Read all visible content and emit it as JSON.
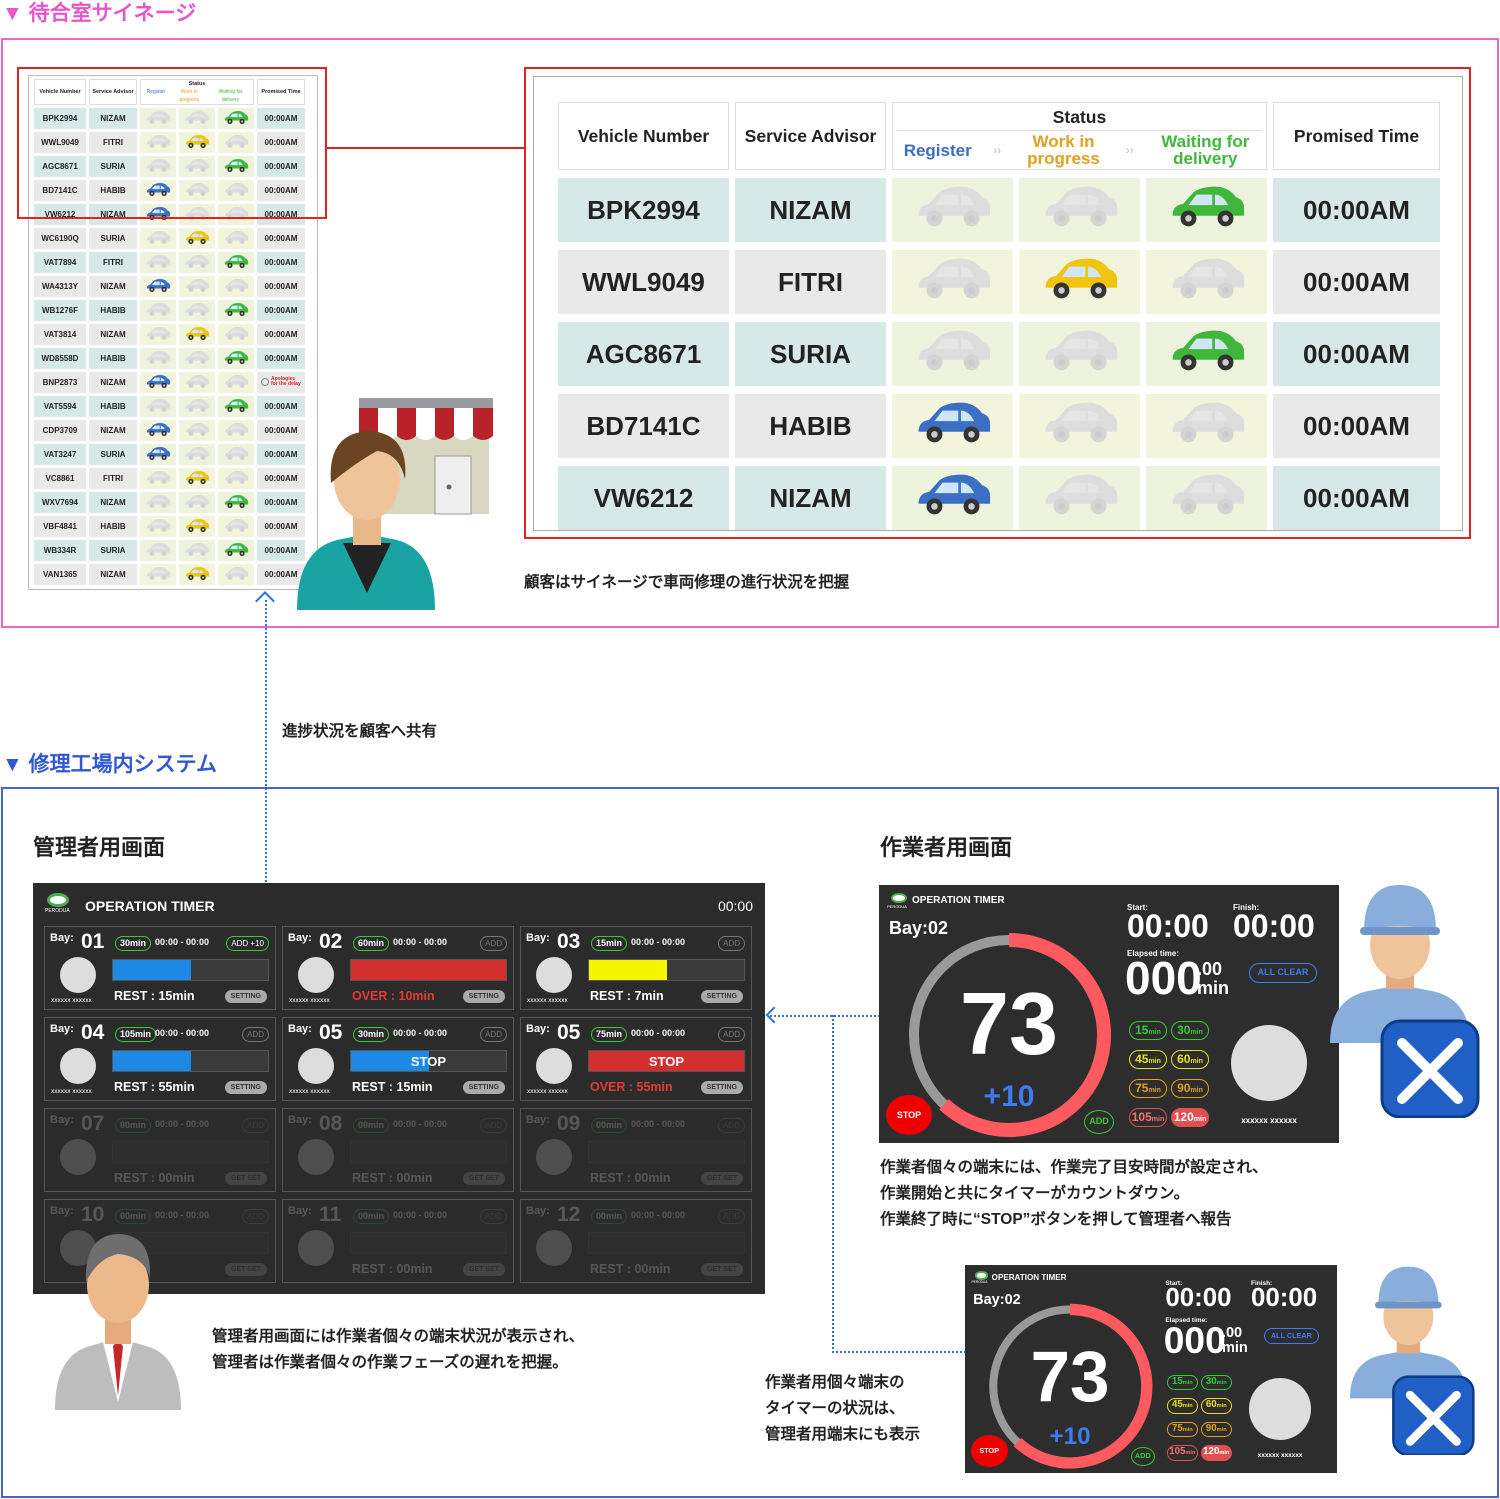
{
  "section1": {
    "title": "▼ 待合室サイネージ"
  },
  "section2": {
    "title": "▼ 修理工場内システム"
  },
  "signage": {
    "headers": {
      "vehicle": "Vehicle Number",
      "advisor": "Service Advisor",
      "status": "Status",
      "register": "Register",
      "work": "Work in progress",
      "waiting": "Waiting for delivery",
      "time": "Promised Time"
    },
    "rows": [
      {
        "vehicle": "BPK2994",
        "advisor": "NIZAM",
        "stage": 3,
        "time": "00:00AM"
      },
      {
        "vehicle": "WWL9049",
        "advisor": "FITRI",
        "stage": 2,
        "time": "00:00AM"
      },
      {
        "vehicle": "AGC8671",
        "advisor": "SURIA",
        "stage": 3,
        "time": "00:00AM"
      },
      {
        "vehicle": "BD7141C",
        "advisor": "HABIB",
        "stage": 1,
        "time": "00:00AM"
      },
      {
        "vehicle": "VW6212",
        "advisor": "NIZAM",
        "stage": 1,
        "time": "00:00AM"
      },
      {
        "vehicle": "WC6190Q",
        "advisor": "SURIA",
        "stage": 2,
        "time": "00:00AM"
      },
      {
        "vehicle": "VAT7894",
        "advisor": "FITRI",
        "stage": 3,
        "time": "00:00AM"
      },
      {
        "vehicle": "WA4313Y",
        "advisor": "NIZAM",
        "stage": 1,
        "time": "00:00AM"
      },
      {
        "vehicle": "WB1276F",
        "advisor": "HABIB",
        "stage": 3,
        "time": "00:00AM"
      },
      {
        "vehicle": "VAT3814",
        "advisor": "NIZAM",
        "stage": 2,
        "time": "00:00AM"
      },
      {
        "vehicle": "WD8558D",
        "advisor": "HABIB",
        "stage": 3,
        "time": "00:00AM"
      },
      {
        "vehicle": "BNP2873",
        "advisor": "NIZAM",
        "stage": 1,
        "time": "Apologies for the delay"
      },
      {
        "vehicle": "VAT5594",
        "advisor": "HABIB",
        "stage": 3,
        "time": "00:00AM"
      },
      {
        "vehicle": "CDP3709",
        "advisor": "NIZAM",
        "stage": 1,
        "time": "00:00AM"
      },
      {
        "vehicle": "VAT3247",
        "advisor": "SURIA",
        "stage": 1,
        "time": "00:00AM"
      },
      {
        "vehicle": "VC8861",
        "advisor": "FITRI",
        "stage": 2,
        "time": "00:00AM"
      },
      {
        "vehicle": "WXV7694",
        "advisor": "NIZAM",
        "stage": 3,
        "time": "00:00AM"
      },
      {
        "vehicle": "VBF4841",
        "advisor": "HABIB",
        "stage": 2,
        "time": "00:00AM"
      },
      {
        "vehicle": "WB334R",
        "advisor": "SURIA",
        "stage": 3,
        "time": "00:00AM"
      },
      {
        "vehicle": "VAN1365",
        "advisor": "NIZAM",
        "stage": 2,
        "time": "00:00AM"
      }
    ]
  },
  "notes": {
    "signage": "顧客はサイネージで車両修理の進行状況を把握",
    "share": "進捗状況を顧客へ共有",
    "admin_line1": "管理者用画面には作業者個々の端末状況が表示され、",
    "admin_line2": "管理者は作業者個々の作業フェーズの遅れを把握。",
    "worker_line1": "作業者個々の端末には、作業完了目安時間が設定され、",
    "worker_line2": "作業開始と共にタイマーがカウントダウン。",
    "worker_line3": "作業終了時に“STOP”ボタンを押して管理者へ報告",
    "mirror_line1": "作業者用個々端末の",
    "mirror_line2": "タイマーの状況は、",
    "mirror_line3": "管理者用端末にも表示"
  },
  "admin": {
    "heading": "管理者用画面",
    "brand": "PERODUA",
    "title": "OPERATION TIMER",
    "clock": "00:00",
    "bay_label": "Bay:",
    "bays": [
      {
        "num": "01",
        "pill": "30min",
        "range": "00:00 - 00:00",
        "add": "ADD +10",
        "user": "xxxxxx xxxxxx",
        "bar_text": "",
        "fill": 0.5,
        "color": "#1e88e5",
        "rest": "REST : 15min",
        "rest_color": "#fff",
        "btn": "SETTING",
        "active": true
      },
      {
        "num": "02",
        "pill": "60min",
        "range": "00:00 - 00:00",
        "add": "ADD",
        "user": "xxxxxx xxxxxx",
        "bar_text": "",
        "fill": 1,
        "color": "#d32f2f",
        "rest": "OVER : 10min",
        "rest_color": "#e53935",
        "btn": "SETTING",
        "active": true
      },
      {
        "num": "03",
        "pill": "15min",
        "range": "00:00 - 00:00",
        "add": "ADD",
        "user": "xxxxxx xxxxxx",
        "bar_text": "",
        "fill": 0.5,
        "color": "#f5f500",
        "rest": "REST : 7min",
        "rest_color": "#fff",
        "btn": "SETTING",
        "active": true
      },
      {
        "num": "04",
        "pill": "105min",
        "range": "00:00 - 00:00",
        "add": "ADD",
        "user": "xxxxxx xxxxxx",
        "bar_text": "",
        "fill": 0.5,
        "color": "#1e88e5",
        "rest": "REST : 55min",
        "rest_color": "#fff",
        "btn": "SETTING",
        "active": true
      },
      {
        "num": "05",
        "pill": "30min",
        "range": "00:00 - 00:00",
        "add": "ADD",
        "user": "xxxxxx xxxxxx",
        "bar_text": "STOP",
        "fill": 0.5,
        "color": "#1e88e5",
        "rest": "REST : 15min",
        "rest_color": "#fff",
        "btn": "SETTING",
        "active": true
      },
      {
        "num": "05",
        "pill": "75min",
        "range": "00:00 - 00:00",
        "add": "ADD",
        "user": "xxxxxx xxxxxx",
        "bar_text": "STOP",
        "fill": 1,
        "color": "#d32f2f",
        "rest": "OVER : 55min",
        "rest_color": "#e53935",
        "btn": "SETTING",
        "active": true
      },
      {
        "num": "07",
        "pill": "00min",
        "range": "00:00 - 00:00",
        "add": "ADD",
        "user": "",
        "bar_text": "",
        "fill": 0,
        "color": "#555",
        "rest": "REST : 00min",
        "rest_color": "#fff",
        "btn": "GET SET",
        "active": false
      },
      {
        "num": "08",
        "pill": "00min",
        "range": "00:00 - 00:00",
        "add": "ADD",
        "user": "",
        "bar_text": "",
        "fill": 0,
        "color": "#555",
        "rest": "REST : 00min",
        "rest_color": "#fff",
        "btn": "GET SET",
        "active": false
      },
      {
        "num": "09",
        "pill": "00min",
        "range": "00:00 - 00:00",
        "add": "ADD",
        "user": "",
        "bar_text": "",
        "fill": 0,
        "color": "#555",
        "rest": "REST : 00min",
        "rest_color": "#fff",
        "btn": "GET SET",
        "active": false
      },
      {
        "num": "10",
        "pill": "00min",
        "range": "00:00 - 00:00",
        "add": "ADD",
        "user": "",
        "bar_text": "",
        "fill": 0,
        "color": "#555",
        "rest": "00min",
        "rest_color": "#fff",
        "btn": "GET SET",
        "active": false
      },
      {
        "num": "11",
        "pill": "00min",
        "range": "00:00 - 00:00",
        "add": "ADD",
        "user": "",
        "bar_text": "",
        "fill": 0,
        "color": "#555",
        "rest": "REST : 00min",
        "rest_color": "#fff",
        "btn": "GET SET",
        "active": false
      },
      {
        "num": "12",
        "pill": "00min",
        "range": "00:00 - 00:00",
        "add": "ADD",
        "user": "",
        "bar_text": "",
        "fill": 0,
        "color": "#555",
        "rest": "REST : 00min",
        "rest_color": "#fff",
        "btn": "GET SET",
        "active": false
      }
    ]
  },
  "worker": {
    "heading": "作業者用画面",
    "brand": "PERODUA",
    "title": "OPERATION TIMER",
    "bay": "Bay:02",
    "start_label": "Start:",
    "finish_label": "Finish:",
    "start": "00:00",
    "finish": "00:00",
    "elapsed_label": "Elapsed time:",
    "elapsed": "000",
    "elapsed_dec": ".00",
    "elapsed_unit": "min",
    "all_clear": "ALL CLEAR",
    "remaining": "73",
    "extra": "+10",
    "progress": 0.62,
    "stop": "STOP",
    "add": "ADD",
    "user": "xxxxxx xxxxxx",
    "chips": [
      {
        "v": "15",
        "u": "min",
        "c": "#3c3",
        "t": "#3c3"
      },
      {
        "v": "30",
        "u": "min",
        "c": "#3c3",
        "t": "#3c3"
      },
      {
        "v": "45",
        "u": "min",
        "c": "#e8e020",
        "t": "#e8e020"
      },
      {
        "v": "60",
        "u": "min",
        "c": "#e8e020",
        "t": "#e8e020"
      },
      {
        "v": "75",
        "u": "min",
        "c": "#e0a020",
        "t": "#e0a020"
      },
      {
        "v": "90",
        "u": "min",
        "c": "#e0a020",
        "t": "#e0a020"
      },
      {
        "v": "105",
        "u": "min",
        "c": "#e05050",
        "t": "#ff7070"
      },
      {
        "v": "120",
        "u": "min",
        "c": "#e05050",
        "t": "#fff"
      }
    ]
  },
  "colors": {
    "pink": "#ee66cc",
    "blue": "#4466cc",
    "red": "#e52222",
    "stage1": "#3a6fc4",
    "stage2": "#f1c40f",
    "stage3": "#3fb83a"
  }
}
